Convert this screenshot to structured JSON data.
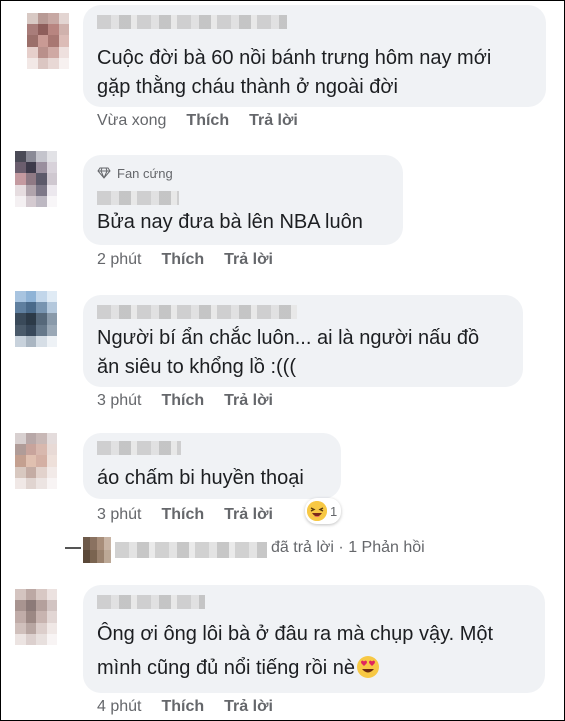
{
  "comments": [
    {
      "text_lines": [
        "Cuộc đời bà 60 nồi bánh trưng hôm nay mới",
        "gặp thằng cháu thành ở ngoài đời"
      ],
      "time": "Vừa xong",
      "like": "Thích",
      "reply": "Trả lời"
    },
    {
      "badge": "Fan cứng",
      "text_lines": [
        "Bửa nay đưa bà lên NBA  luôn"
      ],
      "time": "2 phút",
      "like": "Thích",
      "reply": "Trả lời"
    },
    {
      "text_lines": [
        "Người bí ẩn chắc luôn... ai là người nấu đồ",
        "ăn siêu to khổng lồ :((("
      ],
      "time": "3 phút",
      "like": "Thích",
      "reply": "Trả lời"
    },
    {
      "text_lines": [
        "áo chấm bi huyền thoại"
      ],
      "time": "3 phút",
      "like": "Thích",
      "reply": "Trả lời",
      "reaction_count": "1"
    },
    {
      "text_lines": [
        "Ông ơi ông lôi bà ở đâu ra mà chụp vậy. Một",
        "mình cũng đủ nổi tiếng rồi nè"
      ],
      "time": "4 phút",
      "like": "Thích",
      "reply": "Trả lời"
    }
  ],
  "reply_summary": {
    "text": "đã trả lời",
    "count": "· 1 Phản hồi"
  },
  "colors": {
    "bubble": "#f0f2f5",
    "meta": "#65676b",
    "text": "#1c1e21"
  },
  "icons": [
    "diamond-icon",
    "laughing-emoji-icon",
    "heart-eyes-emoji-icon"
  ]
}
